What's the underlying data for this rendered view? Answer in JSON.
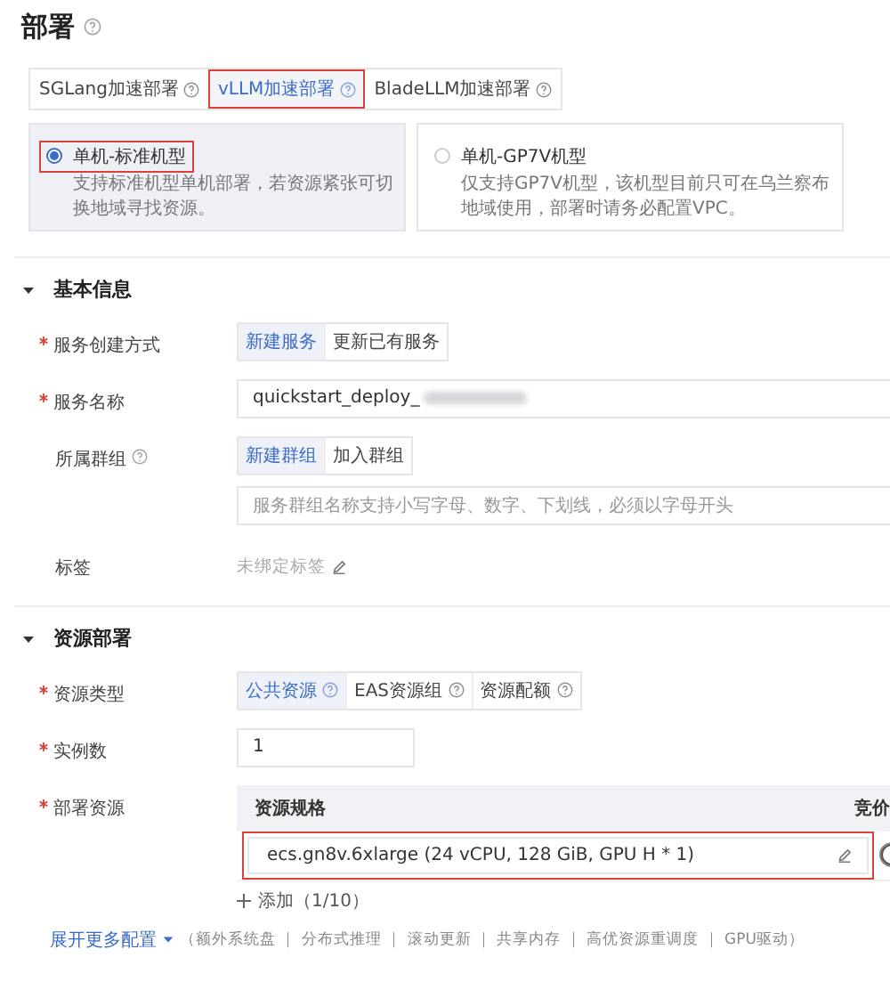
{
  "title": "部署",
  "title_help": true,
  "deploy_tabs": [
    {
      "label": "SGLang加速部署",
      "selected": false,
      "highlighted": false
    },
    {
      "label": "vLLM加速部署",
      "selected": true,
      "highlighted": true
    },
    {
      "label": "BladeLLM加速部署",
      "selected": false,
      "highlighted": false
    }
  ],
  "machine_options": [
    {
      "title": "单机-标准机型",
      "description": "支持标准机型单机部署，若资源紧张可切换地域寻找资源。",
      "selected": true,
      "highlighted": true
    },
    {
      "title": "单机-GP7V机型",
      "description": "仅支持GP7V机型，该机型目前只可在乌兰察布地域使用，部署时请务必配置VPC。",
      "selected": false,
      "highlighted": false
    }
  ],
  "sections": [
    {
      "title": "基本信息",
      "expanded": true,
      "fields": [
        {
          "kind": "segmented",
          "label": "服务创建方式",
          "required": true,
          "options": [
            {
              "label": "新建服务",
              "selected": true
            },
            {
              "label": "更新已有服务",
              "selected": false
            }
          ]
        },
        {
          "kind": "text",
          "label": "服务名称",
          "required": true,
          "value": "quickstart_deploy_",
          "redacted": true,
          "wide": true
        },
        {
          "kind": "segmented",
          "label": "所属群组",
          "required": false,
          "help": true,
          "options": [
            {
              "label": "新建群组",
              "selected": true
            },
            {
              "label": "加入群组",
              "selected": false
            }
          ],
          "placeholder": "服务群组名称支持小写字母、数字、下划线，必须以字母开头"
        },
        {
          "kind": "tags",
          "label": "标签",
          "required": false,
          "value": "未绑定标签"
        }
      ]
    },
    {
      "title": "资源部署",
      "expanded": true,
      "fields": [
        {
          "kind": "segmented",
          "label": "资源类型",
          "required": true,
          "options": [
            {
              "label": "公共资源",
              "selected": true,
              "help": true
            },
            {
              "label": "EAS资源组",
              "selected": false,
              "help": true
            },
            {
              "label": "资源配额",
              "selected": false,
              "help": true
            }
          ]
        },
        {
          "kind": "text",
          "label": "实例数",
          "required": true,
          "value": "1",
          "redacted": false,
          "wide": false
        },
        {
          "kind": "spec_table",
          "label": "部署资源",
          "required": true,
          "columns": [
            "资源规格",
            "竞价"
          ],
          "rows": [
            {
              "spec": "ecs.gn8v.6xlarge  (24 vCPU, 128 GiB, GPU H * 1)",
              "highlighted": true,
              "bidding": false
            }
          ],
          "add_label": "添加（1/10）"
        }
      ]
    }
  ],
  "more": {
    "link": "展开更多配置",
    "expanded": false,
    "items": "（额外系统盘 ｜ 分布式推理 ｜ 滚动更新 ｜ 共享内存 ｜ 高优资源重调度 ｜ GPU驱动）"
  }
}
